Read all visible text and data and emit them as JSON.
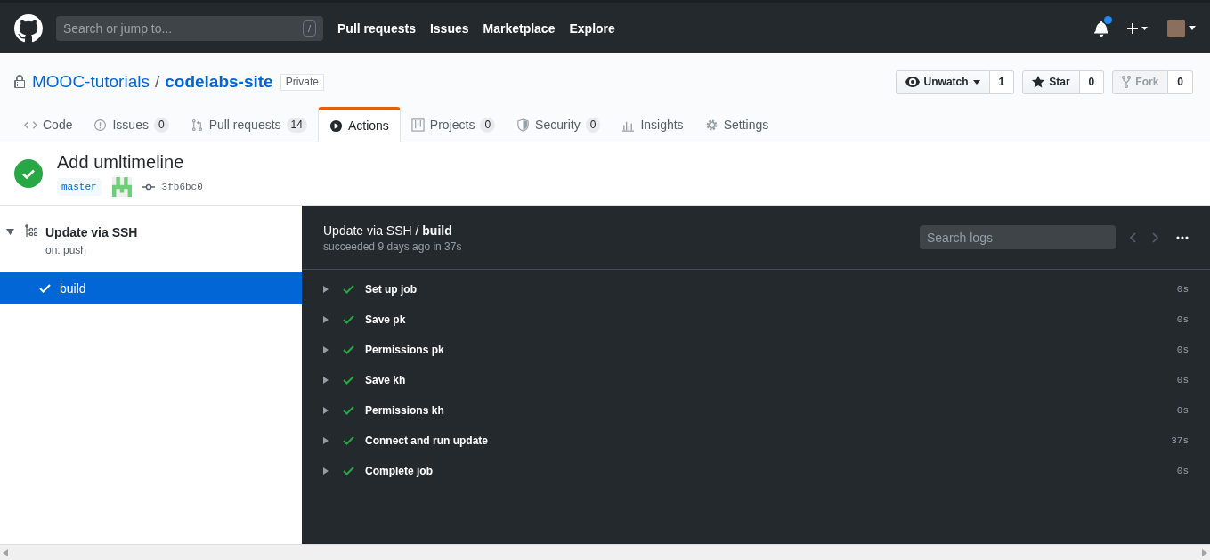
{
  "header": {
    "search_placeholder": "Search or jump to...",
    "search_key": "/",
    "nav": [
      "Pull requests",
      "Issues",
      "Marketplace",
      "Explore"
    ],
    "notification_unread": true
  },
  "repo": {
    "owner": "MOOC-tutorials",
    "separator": "/",
    "name": "codelabs-site",
    "visibility": "Private",
    "buttons": [
      {
        "label": "Unwatch",
        "count": "1",
        "kind": "watch",
        "disabled": false
      },
      {
        "label": "Star",
        "count": "0",
        "kind": "star",
        "disabled": false
      },
      {
        "label": "Fork",
        "count": "0",
        "kind": "fork",
        "disabled": true
      }
    ]
  },
  "tabs": [
    {
      "label": "Code",
      "kind": "code",
      "selected": false
    },
    {
      "label": "Issues",
      "count": "0",
      "kind": "issues",
      "selected": false
    },
    {
      "label": "Pull requests",
      "count": "14",
      "kind": "pulls",
      "selected": false
    },
    {
      "label": "Actions",
      "kind": "actions",
      "selected": true
    },
    {
      "label": "Projects",
      "count": "0",
      "kind": "projects",
      "selected": false
    },
    {
      "label": "Security",
      "count": "0",
      "kind": "security",
      "selected": false
    },
    {
      "label": "Insights",
      "kind": "insights",
      "selected": false
    },
    {
      "label": "Settings",
      "kind": "settings",
      "selected": false
    }
  ],
  "run": {
    "title": "Add umltimeline",
    "branch": "master",
    "commit": "3fb6bc0"
  },
  "sidebar": {
    "workflow": {
      "name": "Update via SSH",
      "trigger": "on: push",
      "expanded": true
    },
    "jobs": [
      {
        "name": "build",
        "selected": true
      }
    ]
  },
  "log": {
    "workflow": "Update via SSH",
    "separator": " / ",
    "job": "build",
    "summary": "succeeded 9 days ago in 37s",
    "search_placeholder": "Search logs",
    "steps": [
      {
        "name": "Set up job",
        "duration": "0s"
      },
      {
        "name": "Save pk",
        "duration": "0s"
      },
      {
        "name": "Permissions pk",
        "duration": "0s"
      },
      {
        "name": "Save kh",
        "duration": "0s"
      },
      {
        "name": "Permissions kh",
        "duration": "0s"
      },
      {
        "name": "Connect and run update",
        "duration": "37s"
      },
      {
        "name": "Complete job",
        "duration": "0s"
      }
    ]
  }
}
